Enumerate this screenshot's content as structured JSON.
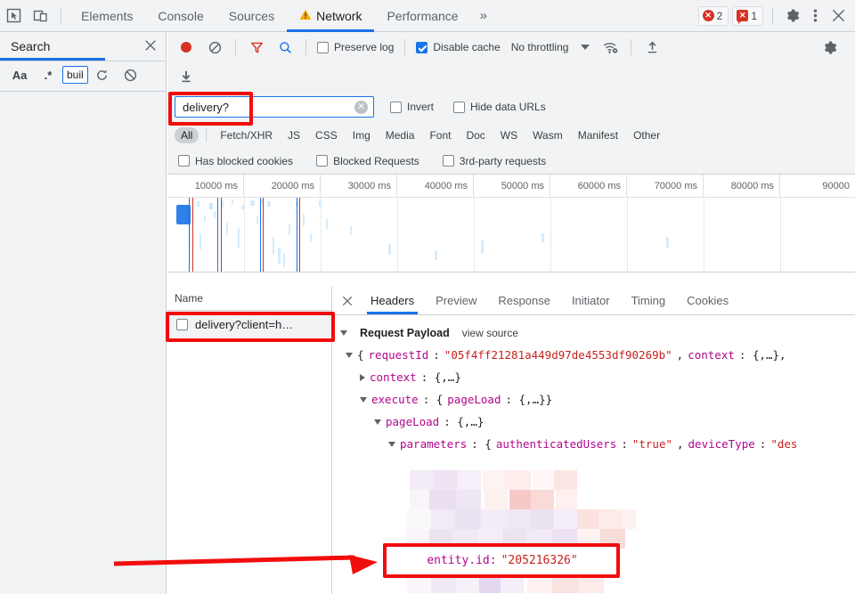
{
  "topbar": {
    "icons": [
      "inspect-icon",
      "device-toggle-icon"
    ],
    "tabs": [
      {
        "label": "Elements",
        "active": false,
        "warning": false
      },
      {
        "label": "Console",
        "active": false,
        "warning": false
      },
      {
        "label": "Sources",
        "active": false,
        "warning": false
      },
      {
        "label": "Network",
        "active": true,
        "warning": true
      },
      {
        "label": "Performance",
        "active": false,
        "warning": false
      }
    ],
    "more_label": "»",
    "errors_count": "2",
    "warnings_count": "1",
    "settings_icon": "gear-icon",
    "menu_icon": "kebab-menu-icon",
    "close_icon": "close-icon",
    "accent": "#1a73e8",
    "error_color": "#d93025",
    "warning_color": "#f9ab00"
  },
  "sidebar": {
    "title": "Search",
    "close_icon": "close-icon",
    "tools": [
      {
        "name": "match-case-toggle",
        "label": "Aa"
      },
      {
        "name": "regex-toggle",
        "label": ".*"
      },
      {
        "name": "refresh-button",
        "label": "↻"
      },
      {
        "name": "clear-button",
        "label": "⊘"
      }
    ],
    "query": "buil"
  },
  "network_toolbar": {
    "record_label": "record-button",
    "clear_label": "clear-button",
    "filter_label": "filter-button",
    "search_label": "search-button",
    "preserve_log": {
      "label": "Preserve log",
      "checked": false
    },
    "disable_cache": {
      "label": "Disable cache",
      "checked": true
    },
    "throttling": {
      "label": "No throttling",
      "wifi_icon": "network-conditions-icon"
    },
    "import_icon": "import-har-icon",
    "export_icon": "export-har-icon",
    "settings_icon": "gear-icon"
  },
  "filter": {
    "value": "delivery?",
    "placeholder": "Filter",
    "clear_icon": "clear-input-icon",
    "invert": {
      "label": "Invert",
      "checked": false
    },
    "hide_data_urls": {
      "label": "Hide data URLs",
      "checked": false
    },
    "types": [
      {
        "label": "All",
        "active": true
      },
      {
        "label": "Fetch/XHR",
        "active": false
      },
      {
        "label": "JS",
        "active": false
      },
      {
        "label": "CSS",
        "active": false
      },
      {
        "label": "Img",
        "active": false
      },
      {
        "label": "Media",
        "active": false
      },
      {
        "label": "Font",
        "active": false
      },
      {
        "label": "Doc",
        "active": false
      },
      {
        "label": "WS",
        "active": false
      },
      {
        "label": "Wasm",
        "active": false
      },
      {
        "label": "Manifest",
        "active": false
      },
      {
        "label": "Other",
        "active": false
      }
    ],
    "checkboxes": [
      {
        "label": "Has blocked cookies",
        "checked": false
      },
      {
        "label": "Blocked Requests",
        "checked": false
      },
      {
        "label": "3rd-party requests",
        "checked": false
      }
    ]
  },
  "overview": {
    "ticks": [
      "10000 ms",
      "20000 ms",
      "30000 ms",
      "40000 ms",
      "50000 ms",
      "60000 ms",
      "70000 ms",
      "80000 ms",
      "90000"
    ]
  },
  "request_list": {
    "column_header": "Name",
    "rows": [
      {
        "name": "delivery?client=h…",
        "icon": "document-icon",
        "selected": true
      }
    ]
  },
  "detail": {
    "close_icon": "close-icon",
    "tabs": [
      {
        "label": "Headers",
        "active": true
      },
      {
        "label": "Preview",
        "active": false
      },
      {
        "label": "Response",
        "active": false
      },
      {
        "label": "Initiator",
        "active": false
      },
      {
        "label": "Timing",
        "active": false
      },
      {
        "label": "Cookies",
        "active": false
      }
    ],
    "section_title": "Request Payload",
    "view_source": "view source",
    "tree": [
      {
        "indent": 0,
        "toggle": "down",
        "parts": [
          {
            "t": "pun",
            "v": "{"
          },
          {
            "t": "key",
            "v": "requestId"
          },
          {
            "t": "pun",
            "v": ": "
          },
          {
            "t": "str",
            "v": "\"05f4ff21281a449d97de4553df90269b\""
          },
          {
            "t": "pun",
            "v": ", "
          },
          {
            "t": "key",
            "v": "context"
          },
          {
            "t": "pun",
            "v": ": {,…},"
          }
        ]
      },
      {
        "indent": 1,
        "toggle": "right",
        "parts": [
          {
            "t": "key",
            "v": "context"
          },
          {
            "t": "pun",
            "v": ": {,…}"
          }
        ]
      },
      {
        "indent": 1,
        "toggle": "down",
        "parts": [
          {
            "t": "key",
            "v": "execute"
          },
          {
            "t": "pun",
            "v": ": {"
          },
          {
            "t": "key",
            "v": "pageLoad"
          },
          {
            "t": "pun",
            "v": ": {,…}}"
          }
        ]
      },
      {
        "indent": 2,
        "toggle": "down",
        "parts": [
          {
            "t": "key",
            "v": "pageLoad"
          },
          {
            "t": "pun",
            "v": ": {,…}"
          }
        ]
      },
      {
        "indent": 3,
        "toggle": "down",
        "parts": [
          {
            "t": "key",
            "v": "parameters"
          },
          {
            "t": "pun",
            "v": ": {"
          },
          {
            "t": "key",
            "v": "authenticatedUsers"
          },
          {
            "t": "pun",
            "v": ": "
          },
          {
            "t": "str",
            "v": "\"true\""
          },
          {
            "t": "pun",
            "v": ", "
          },
          {
            "t": "key",
            "v": "deviceType"
          },
          {
            "t": "pun",
            "v": ": "
          },
          {
            "t": "str",
            "v": "\"des"
          }
        ]
      }
    ]
  },
  "annotations": {
    "entity_key": "entity.id:",
    "entity_value": "\"205216326\"",
    "highlight_color": "#f20d0d",
    "arrow_name": "red-arrow-annotation"
  }
}
